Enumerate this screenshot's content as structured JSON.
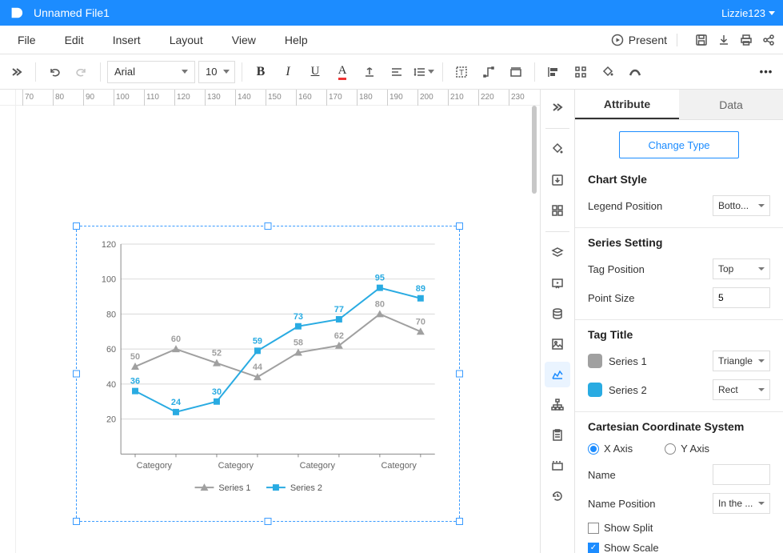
{
  "app": {
    "filename": "Unnamed File1",
    "user": "Lizzie123"
  },
  "menus": {
    "file": "File",
    "edit": "Edit",
    "insert": "Insert",
    "layout": "Layout",
    "view": "View",
    "help": "Help",
    "present": "Present"
  },
  "toolbar": {
    "font": "Arial",
    "size": "10"
  },
  "ruler": {
    "ticks": [
      "70",
      "80",
      "90",
      "100",
      "110",
      "120",
      "130",
      "140",
      "150",
      "160",
      "170",
      "180",
      "190",
      "200",
      "210",
      "220",
      "230"
    ]
  },
  "panel": {
    "tabs": {
      "attribute": "Attribute",
      "data": "Data"
    },
    "change_type": "Change Type",
    "chart_style": {
      "title": "Chart Style",
      "legend_position_label": "Legend Position",
      "legend_position": "Botto..."
    },
    "series_setting": {
      "title": "Series Setting",
      "tag_position_label": "Tag Position",
      "tag_position": "Top",
      "point_size_label": "Point Size",
      "point_size": "5"
    },
    "tag_title": {
      "title": "Tag Title",
      "s1_label": "Series 1",
      "s1_shape": "Triangle",
      "s2_label": "Series 2",
      "s2_shape": "Rect"
    },
    "axis": {
      "title": "Cartesian Coordinate System",
      "x": "X Axis",
      "y": "Y Axis",
      "name_label": "Name",
      "name": "",
      "name_pos_label": "Name Position",
      "name_pos": "In the ...",
      "show_split": "Show Split",
      "show_scale": "Show Scale"
    }
  },
  "chart_data": {
    "type": "line",
    "categories": [
      "Category",
      "Category",
      "Category",
      "Category",
      "Category",
      "Category",
      "Category",
      "Category"
    ],
    "series": [
      {
        "name": "Series 1",
        "values": [
          50,
          60,
          52,
          44,
          58,
          62,
          80,
          70
        ],
        "color": "#a0a0a0",
        "shape": "triangle"
      },
      {
        "name": "Series 2",
        "values": [
          36,
          24,
          30,
          59,
          73,
          77,
          95,
          89
        ],
        "color": "#29abe2",
        "shape": "rect"
      }
    ],
    "ylim": [
      0,
      120
    ],
    "yticks": [
      20,
      40,
      60,
      80,
      100,
      120
    ],
    "xlabel": "",
    "ylabel": "",
    "title": ""
  }
}
